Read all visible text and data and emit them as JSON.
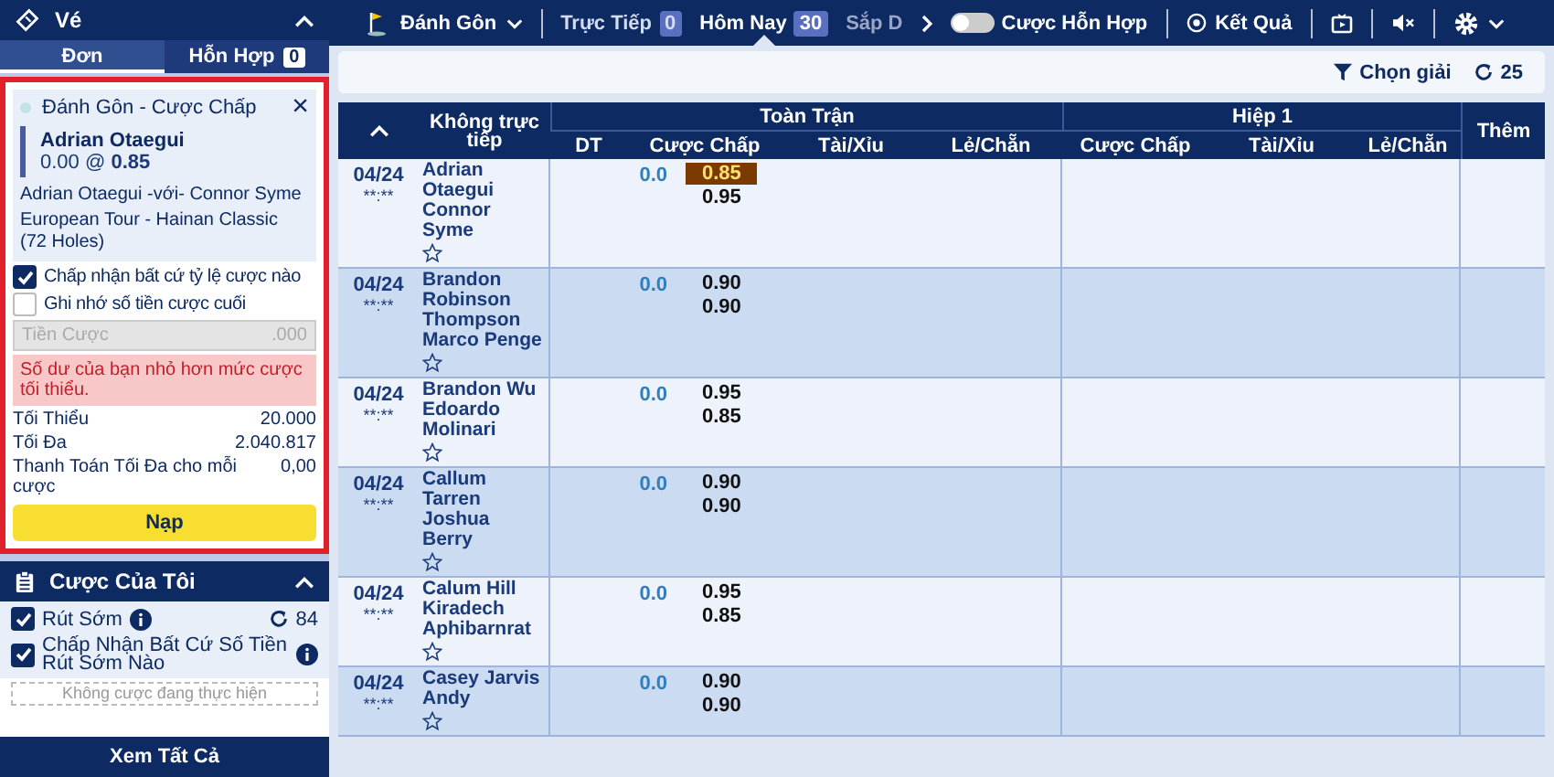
{
  "sidebar": {
    "title": "Vé",
    "tabs": [
      {
        "label": "Đơn",
        "selected": true
      },
      {
        "label": "Hỗn Hợp",
        "selected": false,
        "badge": "0"
      }
    ],
    "slip": {
      "title": "Đánh Gôn - Cược Chấp",
      "close": "×",
      "selection": "Adrian Otaegui",
      "price": "0.00 @ **0.85**",
      "match": "Adrian Otaegui -với- Connor Syme",
      "league": "European Tour - Hainan Classic (72 Holes)",
      "options": [
        {
          "label": "Chấp nhận bất cứ tỷ lệ cược nào",
          "checked": true
        },
        {
          "label": "Ghi nhớ số tiền cược cuối",
          "checked": false
        }
      ],
      "stake": {
        "placeholder": "Tiền Cược",
        "suffix": ".000",
        "disabled": true
      },
      "error": "Số dư của bạn nhỏ hơn mức cược tối thiểu.",
      "limits": [
        {
          "label": "Tối Thiểu",
          "value": "20.000"
        },
        {
          "label": "Tối Đa",
          "value": "2.040.817"
        },
        {
          "label": "Thanh Toán Tối Đa cho mỗi cược",
          "value": "0,00"
        }
      ],
      "button": "Nạp"
    },
    "my_bets": {
      "title": "Cược Của Tôi",
      "options": [
        {
          "label": "Rút Sớm",
          "checked": true,
          "count": "84"
        },
        {
          "label": "Chấp Nhận Bất Cứ Số Tiền Rút Sớm Nào",
          "checked": true
        }
      ],
      "empty": "Không cược đang thực hiện",
      "button": "Xem Tất Cả"
    }
  },
  "nav": {
    "sport": "Đánh Gôn",
    "tabs": [
      {
        "label": "Trực Tiếp",
        "badge": "0",
        "selected": false
      },
      {
        "label": "Hôm Nay",
        "badge": "30",
        "selected": true
      },
      {
        "label": "Sắp D",
        "selected": false
      }
    ],
    "toggle": {
      "label": "Cược Hỗn Hợp",
      "on": false
    },
    "results": "Kết Quả"
  },
  "filter": {
    "label": "Chọn giải",
    "count": "25"
  },
  "table": {
    "group_headers": [
      "Không trực tiếp",
      "Toàn Trận",
      "Hiệp 1",
      "Thêm"
    ],
    "columns": [
      "DT",
      "Cược Chấp",
      "Tài/Xỉu",
      "Lẻ/Chẵn",
      "Cược Chấp",
      "Tài/Xỉu",
      "Lẻ/Chẵn"
    ],
    "rows": [
      {
        "date": "04/24",
        "time": "**:**",
        "players": [
          "Adrian Otaegui",
          "Connor Syme"
        ],
        "handicap": "0.0",
        "odds": [
          {
            "value": "0.85",
            "selected": true
          },
          {
            "value": "0.95",
            "selected": false
          }
        ]
      },
      {
        "date": "04/24",
        "time": "**:**",
        "players": [
          "Brandon Robinson Thompson",
          "Marco Penge"
        ],
        "handicap": "0.0",
        "odds": [
          {
            "value": "0.90",
            "selected": false
          },
          {
            "value": "0.90",
            "selected": false
          }
        ]
      },
      {
        "date": "04/24",
        "time": "**:**",
        "players": [
          "Brandon Wu",
          "Edoardo Molinari"
        ],
        "handicap": "0.0",
        "odds": [
          {
            "value": "0.95",
            "selected": false
          },
          {
            "value": "0.85",
            "selected": false
          }
        ]
      },
      {
        "date": "04/24",
        "time": "**:**",
        "players": [
          "Callum Tarren",
          "Joshua Berry"
        ],
        "handicap": "0.0",
        "odds": [
          {
            "value": "0.90",
            "selected": false
          },
          {
            "value": "0.90",
            "selected": false
          }
        ]
      },
      {
        "date": "04/24",
        "time": "**:**",
        "players": [
          "Calum Hill",
          "Kiradech Aphibarnrat"
        ],
        "handicap": "0.0",
        "odds": [
          {
            "value": "0.95",
            "selected": false
          },
          {
            "value": "0.85",
            "selected": false
          }
        ]
      },
      {
        "date": "04/24",
        "time": "**:**",
        "players": [
          "Casey Jarvis",
          "Andy"
        ],
        "handicap": "0.0",
        "odds": [
          {
            "value": "0.90",
            "selected": false
          },
          {
            "value": "0.90",
            "selected": false
          }
        ]
      }
    ]
  }
}
